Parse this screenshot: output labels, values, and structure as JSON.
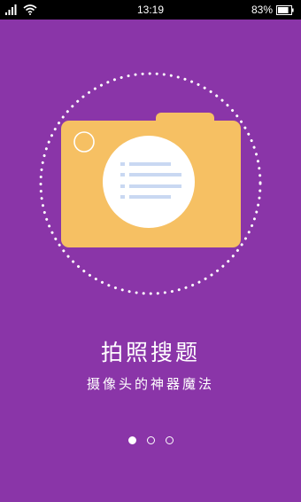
{
  "status_bar": {
    "time": "13:19",
    "battery": "83%",
    "battery_level": 0.83,
    "icons": [
      "signal-icon",
      "wifi-icon",
      "battery-icon"
    ]
  },
  "onboarding": {
    "title": "拍照搜题",
    "subtitle": "摄像头的神器魔法",
    "page_indicator": {
      "total": 3,
      "current": 1
    }
  },
  "colors": {
    "background": "#8a35a8",
    "camera_body": "#f6c063",
    "camera_lens": "#ffffff",
    "lens_lines": "#c9d8f2",
    "dotted_circle": "#ffffff"
  }
}
